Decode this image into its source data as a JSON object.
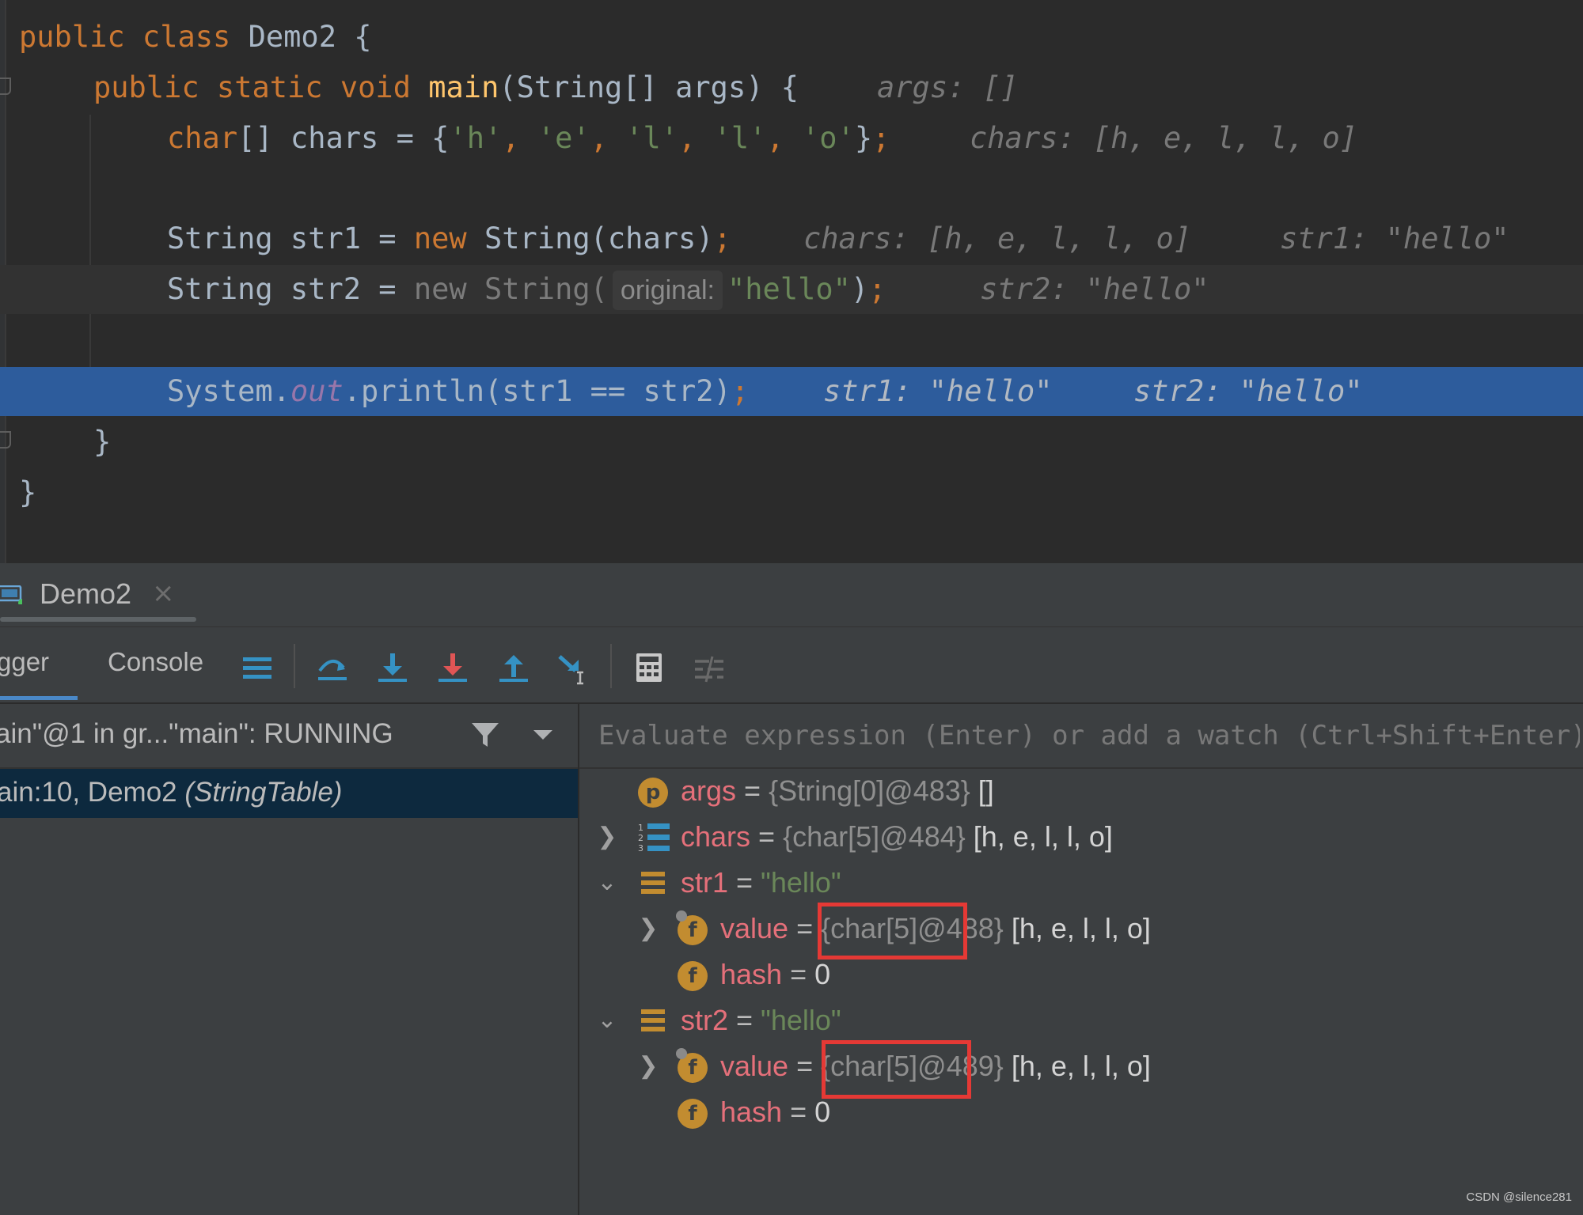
{
  "editor": {
    "line1": {
      "kw": "public class",
      "name": "Demo2",
      "brace": "{"
    },
    "line2": {
      "kw": "public static void",
      "method": "main",
      "params": "(String[] args) {",
      "inline": "args: []"
    },
    "line3": {
      "kw": "char",
      "code": "[] chars = {",
      "c1": "'h'",
      "c2": "'e'",
      "c3": "'l'",
      "c4": "'l'",
      "c5": "'o'",
      "sep": ", ",
      "close": "}",
      "semi": ";",
      "inline": "chars: [h, e, l, l, o]"
    },
    "line4": {
      "pre": "String str1 = ",
      "kw": "new",
      "post": " String(chars)",
      "semi": ";",
      "inline1": "chars: [h, e, l, l, o]",
      "inline2": "str1: \"hello\""
    },
    "line5": {
      "pre": "String str2 = ",
      "dim": "new String(",
      "hint": "original:",
      "str": "\"hello\"",
      "post": ")",
      "semi": ";",
      "inline": "str2: \"hello\""
    },
    "line6": {
      "pre": "System.",
      "field": "out",
      "post": ".println(str1 == str2)",
      "semi": ";",
      "inline1": "str1: \"hello\"",
      "inline2": "str2: \"hello\""
    },
    "line7": {
      "brace": "}"
    },
    "line8": {
      "brace": "}"
    }
  },
  "run_tab": {
    "label": "Demo2",
    "close": "×"
  },
  "toolbar": {
    "debugger_tab": "gger",
    "console_tab": "Console"
  },
  "threads": {
    "selected": "ain\"@1 in gr...\"main\": RUNNING"
  },
  "frames": [
    {
      "text": "ain:10, Demo2 ",
      "context": "(StringTable)"
    }
  ],
  "evaluate": {
    "placeholder": "Evaluate expression (Enter) or add a watch (Ctrl+Shift+Enter)"
  },
  "variables": {
    "args": {
      "badge": "p",
      "name": "args",
      "eq": " = ",
      "type": "{String[0]@483}",
      "value": " []"
    },
    "chars": {
      "name": "chars",
      "eq": " = ",
      "type": "{char[5]@484}",
      "value": " [h, e, l, l, o]"
    },
    "str1": {
      "name": "str1",
      "eq": " = ",
      "value": "\"hello\""
    },
    "str1_value": {
      "badge": "f",
      "name": "value",
      "eq": " = ",
      "type": "{char[5]@488}",
      "value": " [h, e, l, l, o]"
    },
    "str1_hash": {
      "badge": "f",
      "name": "hash",
      "eq": " = ",
      "value": "0"
    },
    "str2": {
      "name": "str2",
      "eq": " = ",
      "value": "\"hello\""
    },
    "str2_value": {
      "badge": "f",
      "name": "value",
      "eq": " = ",
      "type": "{char[5]@489}",
      "value": " [h, e, l, l, o]"
    },
    "str2_hash": {
      "badge": "f",
      "name": "hash",
      "eq": " = ",
      "value": "0"
    }
  },
  "watermark": "CSDN @silence281",
  "colors": {
    "exec_line": "#2d5c9c",
    "highlight_box": "#e53935",
    "keyword": "#cc7832",
    "string": "#6a8759",
    "var_name": "#e5707a"
  }
}
